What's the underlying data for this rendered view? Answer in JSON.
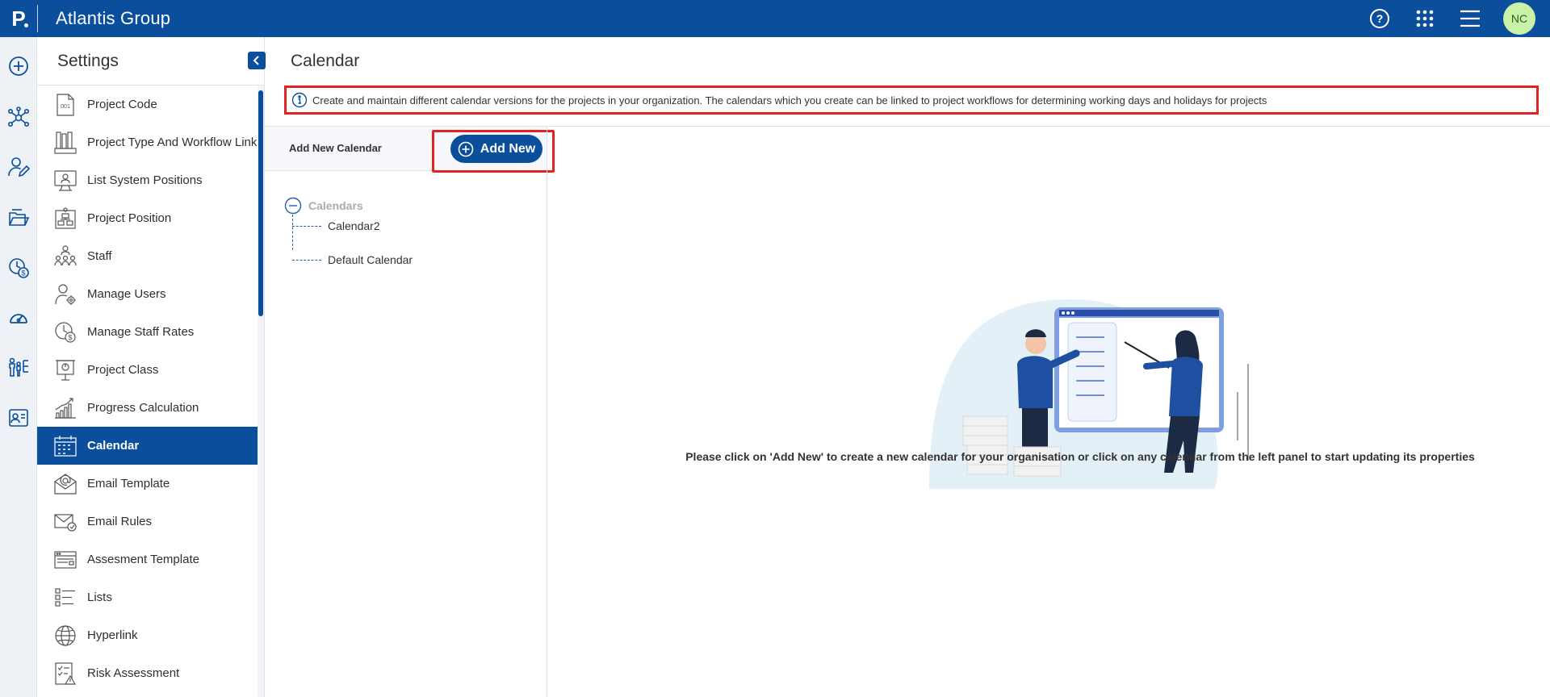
{
  "app": {
    "logo_letter": "P",
    "title": "Atlantis Group",
    "avatar_initials": "NC"
  },
  "topbar_icons": [
    "help-icon",
    "apps-grid-icon",
    "hamburger-menu-icon"
  ],
  "rail_icons": [
    "add-circle-icon",
    "network-icon",
    "user-edit-icon",
    "folders-icon",
    "timesheet-dollar-icon",
    "dashboard-gauge-icon",
    "org-chart-icon",
    "contact-card-icon"
  ],
  "settings": {
    "title": "Settings",
    "items": [
      {
        "label": "Project Code",
        "icon": "project-code-icon"
      },
      {
        "label": "Project Type And Workflow Link",
        "icon": "workflow-link-icon"
      },
      {
        "label": "List System Positions",
        "icon": "system-positions-icon"
      },
      {
        "label": "Project Position",
        "icon": "project-position-icon"
      },
      {
        "label": "Staff",
        "icon": "staff-icon"
      },
      {
        "label": "Manage Users",
        "icon": "manage-users-icon"
      },
      {
        "label": "Manage Staff Rates",
        "icon": "staff-rates-icon"
      },
      {
        "label": "Project Class",
        "icon": "project-class-icon"
      },
      {
        "label": "Progress Calculation",
        "icon": "progress-calculation-icon"
      },
      {
        "label": "Calendar",
        "icon": "calendar-icon",
        "active": true
      },
      {
        "label": "Email Template",
        "icon": "email-template-icon"
      },
      {
        "label": "Email Rules",
        "icon": "email-rules-icon"
      },
      {
        "label": "Assesment Template",
        "icon": "assessment-template-icon"
      },
      {
        "label": "Lists",
        "icon": "lists-icon"
      },
      {
        "label": "Hyperlink",
        "icon": "hyperlink-globe-icon"
      },
      {
        "label": "Risk Assessment",
        "icon": "risk-assessment-icon"
      }
    ]
  },
  "main": {
    "title": "Calendar",
    "info_text": "Create and maintain different calendar versions for the projects in your organization. The calendars which you create can be linked to project workflows for determining working days and holidays for projects",
    "add_label": "Add New Calendar",
    "add_button": "Add New",
    "tree": {
      "root": "Calendars",
      "children": [
        "Calendar2",
        "Default Calendar"
      ]
    },
    "hint": "Please click on 'Add New' to create a new calendar for your organisation or click on any calendar from the left panel to start updating its properties"
  },
  "colors": {
    "brand": "#0b4f9c",
    "highlight_border": "#e02424",
    "avatar_bg": "#c9f2a8"
  }
}
